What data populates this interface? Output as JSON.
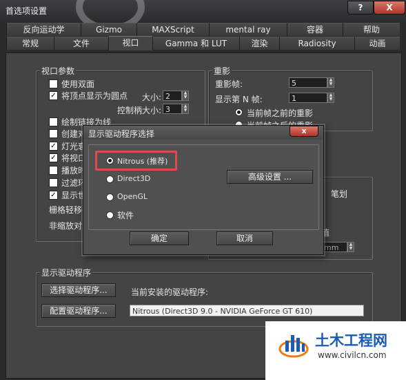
{
  "window": {
    "title": "首选项设置",
    "help_btn": "?",
    "close_btn": "X"
  },
  "tabs": {
    "row1": [
      "反向运动学",
      "Gizmo",
      "MAXScript",
      "mental ray",
      "容器",
      "帮助"
    ],
    "row2": [
      "常规",
      "文件",
      "视口",
      "Gamma 和 LUT",
      "渲染",
      "Radiosity",
      "动画"
    ],
    "active": "视口"
  },
  "viewport_params": {
    "label": "视口参数",
    "items": [
      {
        "label": "使用双面",
        "checked": false
      },
      {
        "label": "将顶点显示为圆点",
        "checked": true
      },
      {
        "label": "绘制链接为线",
        "checked": false
      },
      {
        "label": "创建对",
        "checked": false
      },
      {
        "label": "灯光衰",
        "checked": true
      },
      {
        "label": "将视口",
        "checked": true
      },
      {
        "label": "播放时",
        "checked": false
      },
      {
        "label": "过滤环",
        "checked": false
      },
      {
        "label": "显示世",
        "checked": true
      }
    ],
    "size_label": "大小:",
    "size_value": "2",
    "handle_size_label": "控制柄大小:",
    "handle_size_value": "3",
    "grid_nudge_label": "栅格轻移",
    "nonscale_label": "非缩放对"
  },
  "ghosting": {
    "label": "重影",
    "frames_label": "重影帧:",
    "frames_value": "5",
    "nth_label": "显示第 N 帧:",
    "nth_value": "1",
    "option1": "当前帧之前的重影",
    "option2_partial": "当前帧之后的重影"
  },
  "right_partial": {
    "stroke_label": "笔划",
    "unit_fragment": "mm",
    "edge_char": "值"
  },
  "driver_section": {
    "label": "显示驱动程序",
    "choose_button": "选择驱动程序...",
    "configure_button": "配置驱动程序...",
    "current_label": "当前安装的驱动程序:",
    "current_value": "Nitrous (Direct3D 9.0 - NVIDIA GeForce GT 610)"
  },
  "dialog": {
    "title": "显示驱动程序选择",
    "close": "x",
    "options": [
      "Nitrous (推荐)",
      "Direct3D",
      "OpenGL",
      "软件"
    ],
    "selected": 0,
    "advanced_button": "高级设置 ...",
    "ok": "确定",
    "cancel": "取消"
  },
  "watermark": {
    "brand": "土木工程网",
    "url": "www.civilcn.com"
  },
  "colors": {
    "accent_highlight": "#e24a4a",
    "watermark_blue": "#1a5bb5",
    "watermark_orange": "#f07a12"
  }
}
